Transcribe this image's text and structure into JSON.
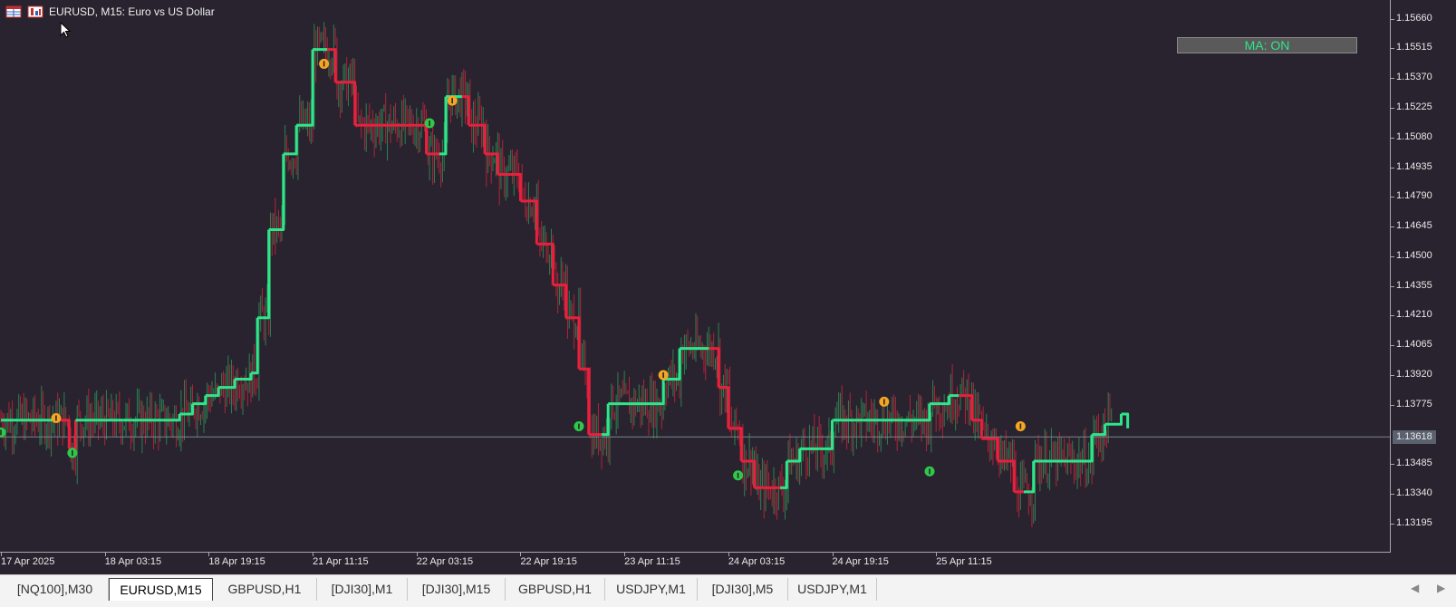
{
  "window": {
    "title": "EURUSD, M15:  Euro vs US Dollar",
    "icons": [
      "chart-list-icon",
      "save-chart-icon"
    ]
  },
  "indicator_panel": {
    "label": "MA: ON"
  },
  "colors": {
    "background": "#28232e",
    "bull_line": "#2ee68a",
    "bear_line": "#e8203c",
    "up_arrow": "#2fc94a",
    "down_arrow": "#f5a623",
    "candle_up": "#2e8b57",
    "candle_down": "#c0243c"
  },
  "current_price": "1.13618",
  "tabs": [
    {
      "label": "[NQ100],M30",
      "active": false
    },
    {
      "label": "EURUSD,M15",
      "active": true
    },
    {
      "label": "GBPUSD,H1",
      "active": false
    },
    {
      "label": "[DJI30],M1",
      "active": false
    },
    {
      "label": "[DJI30],M15",
      "active": false
    },
    {
      "label": "GBPUSD,H1",
      "active": false
    },
    {
      "label": "USDJPY,M1",
      "active": false
    },
    {
      "label": "[DJI30],M5",
      "active": false
    },
    {
      "label": "USDJPY,M1",
      "active": false
    }
  ],
  "tab_nav": {
    "left": "◀",
    "right": "▶"
  },
  "chart_data": {
    "type": "line",
    "symbol": "EURUSD",
    "timeframe": "M15",
    "ylim": [
      1.13115,
      1.15725
    ],
    "y_ticks": [
      "1.15660",
      "1.15515",
      "1.15370",
      "1.15225",
      "1.15080",
      "1.14935",
      "1.14790",
      "1.14645",
      "1.14500",
      "1.14355",
      "1.14210",
      "1.14065",
      "1.13920",
      "1.13775",
      "1.13618",
      "1.13485",
      "1.13340",
      "1.13195"
    ],
    "x_ticks": [
      "17 Apr 2025",
      "18 Apr 03:15",
      "18 Apr 19:15",
      "21 Apr 11:15",
      "22 Apr 03:15",
      "22 Apr 19:15",
      "23 Apr 11:15",
      "24 Apr 03:15",
      "24 Apr 19:15",
      "25 Apr 11:15"
    ],
    "bars_per_tick": 64,
    "total_bars": 625,
    "trend_line": {
      "name": "MA",
      "points": [
        [
          0,
          1.137,
          "up"
        ],
        [
          34,
          1.137,
          "dn"
        ],
        [
          42,
          1.1356,
          "dn"
        ],
        [
          46,
          1.137,
          "up"
        ],
        [
          80,
          1.137,
          "up"
        ],
        [
          110,
          1.1373,
          "up"
        ],
        [
          118,
          1.1378,
          "up"
        ],
        [
          126,
          1.1382,
          "up"
        ],
        [
          134,
          1.1386,
          "up"
        ],
        [
          144,
          1.139,
          "up"
        ],
        [
          154,
          1.1393,
          "up"
        ],
        [
          158,
          1.142,
          "up"
        ],
        [
          165,
          1.1463,
          "up"
        ],
        [
          174,
          1.15,
          "up"
        ],
        [
          182,
          1.1514,
          "up"
        ],
        [
          192,
          1.1551,
          "up"
        ],
        [
          201,
          1.1551,
          "dn"
        ],
        [
          206,
          1.1535,
          "dn"
        ],
        [
          218,
          1.1514,
          "dn"
        ],
        [
          260,
          1.1514,
          "dn"
        ],
        [
          262,
          1.15,
          "dn"
        ],
        [
          270,
          1.15,
          "up"
        ],
        [
          274,
          1.1528,
          "up"
        ],
        [
          284,
          1.1528,
          "dn"
        ],
        [
          288,
          1.1514,
          "dn"
        ],
        [
          298,
          1.15,
          "dn"
        ],
        [
          306,
          1.149,
          "dn"
        ],
        [
          320,
          1.1477,
          "dn"
        ],
        [
          330,
          1.1456,
          "dn"
        ],
        [
          340,
          1.1436,
          "dn"
        ],
        [
          348,
          1.142,
          "dn"
        ],
        [
          356,
          1.1395,
          "dn"
        ],
        [
          362,
          1.1363,
          "dn"
        ],
        [
          370,
          1.1363,
          "up"
        ],
        [
          374,
          1.1378,
          "up"
        ],
        [
          400,
          1.1378,
          "up"
        ],
        [
          408,
          1.139,
          "up"
        ],
        [
          418,
          1.1405,
          "up"
        ],
        [
          436,
          1.1405,
          "dn"
        ],
        [
          442,
          1.1386,
          "dn"
        ],
        [
          448,
          1.1366,
          "dn"
        ],
        [
          456,
          1.135,
          "dn"
        ],
        [
          464,
          1.1337,
          "dn"
        ],
        [
          480,
          1.1337,
          "up"
        ],
        [
          484,
          1.135,
          "up"
        ],
        [
          492,
          1.1356,
          "up"
        ],
        [
          504,
          1.1356,
          "up"
        ],
        [
          512,
          1.137,
          "up"
        ],
        [
          560,
          1.137,
          "up"
        ],
        [
          572,
          1.1378,
          "up"
        ],
        [
          584,
          1.1382,
          "up"
        ],
        [
          590,
          1.1382,
          "dn"
        ],
        [
          598,
          1.137,
          "dn"
        ],
        [
          604,
          1.1361,
          "dn"
        ],
        [
          614,
          1.135,
          "dn"
        ],
        [
          624,
          1.1335,
          "dn"
        ],
        [
          630,
          1.1335,
          "up"
        ],
        [
          636,
          1.135,
          "up"
        ],
        [
          664,
          1.135,
          "up"
        ],
        [
          672,
          1.1363,
          "up"
        ],
        [
          680,
          1.1368,
          "up"
        ],
        [
          690,
          1.1373,
          "up"
        ],
        [
          694,
          1.1366,
          "dn"
        ]
      ]
    },
    "signals": [
      {
        "bar": 0,
        "price": 1.1364,
        "kind": "up"
      },
      {
        "bar": 34,
        "price": 1.1371,
        "kind": "down"
      },
      {
        "bar": 44,
        "price": 1.1354,
        "kind": "up"
      },
      {
        "bar": 199,
        "price": 1.1544,
        "kind": "down"
      },
      {
        "bar": 264,
        "price": 1.1515,
        "kind": "up"
      },
      {
        "bar": 278,
        "price": 1.1526,
        "kind": "down"
      },
      {
        "bar": 356,
        "price": 1.1367,
        "kind": "up"
      },
      {
        "bar": 408,
        "price": 1.1392,
        "kind": "down"
      },
      {
        "bar": 454,
        "price": 1.1343,
        "kind": "up"
      },
      {
        "bar": 544,
        "price": 1.1379,
        "kind": "down"
      },
      {
        "bar": 572,
        "price": 1.1345,
        "kind": "up"
      },
      {
        "bar": 628,
        "price": 1.1367,
        "kind": "down"
      }
    ]
  }
}
